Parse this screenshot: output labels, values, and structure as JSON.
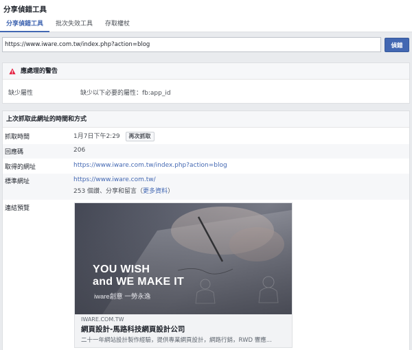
{
  "app": {
    "title": "分享偵錯工具"
  },
  "tabs": [
    {
      "label": "分享偵錯工具",
      "active": true
    },
    {
      "label": "批次失效工具",
      "active": false
    },
    {
      "label": "存取權杖",
      "active": false
    }
  ],
  "url_bar": {
    "value": "https://www.iware.com.tw/index.php?action=blog",
    "button_label": "偵錯"
  },
  "warnings": {
    "title": "應處理的警告",
    "icon": "warning-icon",
    "icon_color": "#e41e3f",
    "items": [
      {
        "label": "缺少屬性",
        "value": "缺少以下必要的屬性：fb:app_id"
      }
    ]
  },
  "last_scrape": {
    "title": "上次抓取此網址的時間和方式",
    "rows": {
      "fetch_time": {
        "label": "抓取時間",
        "value": "1月7日下午2:29",
        "button": "再次抓取"
      },
      "response_code": {
        "label": "回應碼",
        "value": "206"
      },
      "fetched_url": {
        "label": "取得的網址",
        "value": "https://www.iware.com.tw/index.php?action=blog"
      },
      "canonical_url": {
        "label": "標準網址",
        "value": "https://www.iware.com.tw/",
        "stats": "253 個讚、分享和留言（",
        "more": "更多資料",
        "stats_end": "）"
      },
      "link_preview": {
        "label": "連結預覽"
      }
    }
  },
  "preview": {
    "image_text_1": "YOU WISH",
    "image_text_2": "and WE MAKE IT",
    "image_text_3": "iware創意 一勞永逸",
    "domain": "IWARE.COM.TW",
    "title": "網頁設計-馬路科技網頁設計公司",
    "description": "二十一年網站設計製作經驗，提供專業網頁設計，網路行銷，RWD 響應..."
  },
  "colors": {
    "accent": "#4267b2",
    "warning": "#e41e3f"
  }
}
